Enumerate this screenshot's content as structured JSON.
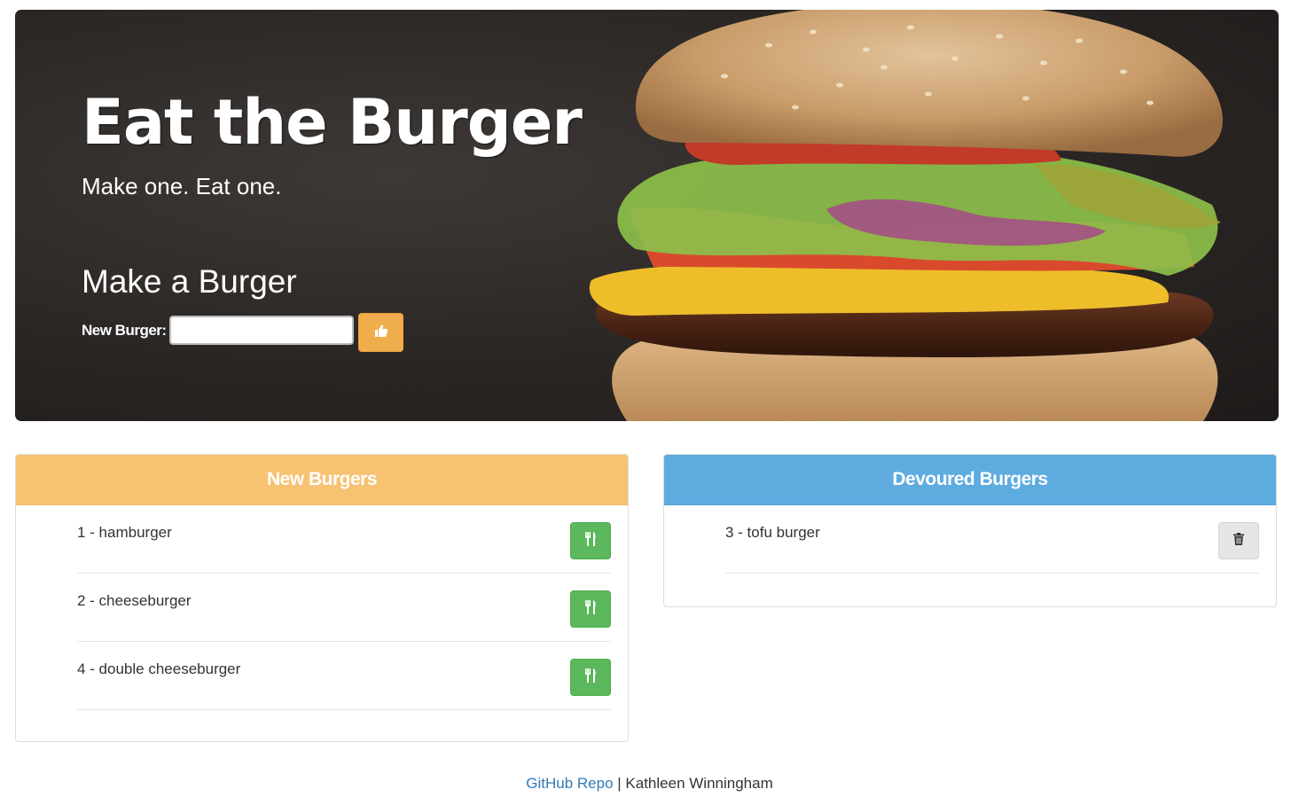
{
  "hero": {
    "title": "Eat the Burger",
    "tagline": "Make one. Eat one.",
    "form_heading": "Make a Burger",
    "form_label": "New Burger:",
    "input_value": "",
    "submit_icon": "thumbs-up-icon"
  },
  "new_burgers": {
    "heading": "New Burgers",
    "action_icon": "utensils-icon",
    "items": [
      {
        "label": "1 - hamburger"
      },
      {
        "label": "2 - cheeseburger"
      },
      {
        "label": "4 - double cheeseburger"
      }
    ]
  },
  "devoured_burgers": {
    "heading": "Devoured Burgers",
    "action_icon": "trash-icon",
    "items": [
      {
        "label": "3 - tofu burger"
      }
    ]
  },
  "footer": {
    "link_text": "GitHub Repo",
    "separator": " | ",
    "author": "Kathleen Winningham"
  },
  "colors": {
    "new_header": "#f7c272",
    "devoured_header": "#5eabe0",
    "eat_button": "#5cb85c",
    "submit_button": "#f0ad4e",
    "delete_button": "#e6e6e6",
    "link": "#337ab7"
  }
}
